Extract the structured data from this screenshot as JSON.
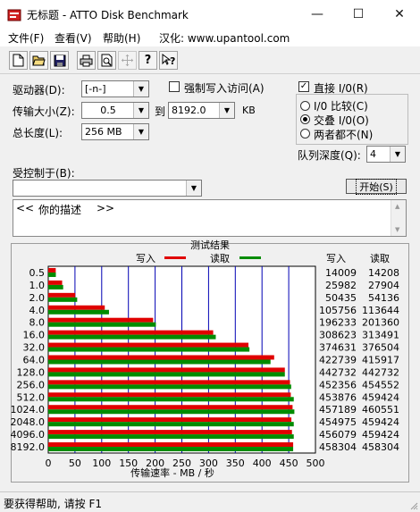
{
  "window": {
    "title": "无标题 - ATTO Disk Benchmark",
    "minimize": "—",
    "maximize": "☐",
    "close": "✕"
  },
  "menu": {
    "file": "文件(F)",
    "view": "查看(V)",
    "help": "帮助(H)",
    "credit": "汉化: www.upantool.com"
  },
  "toolbar_icons": [
    "new-icon",
    "open-icon",
    "save-icon",
    "print-icon",
    "print-preview-icon",
    "move-icon",
    "help-icon",
    "context-help-icon"
  ],
  "settings": {
    "drive_label": "驱动器(D):",
    "drive_value": "[-n-]",
    "transfer_label": "传输大小(Z):",
    "transfer_from": "0.5",
    "to_label": "到",
    "transfer_to": "8192.0",
    "kb_label": "KB",
    "length_label": "总长度(L):",
    "length_value": "256 MB",
    "force_write_label": "强制写入访问(A)",
    "force_write_checked": false,
    "direct_io_label": "直接 I/0(R)",
    "direct_io_checked": true,
    "io_compare_label": "I/0 比较(C)",
    "overlapped_io_label": "交叠 I/0(O)",
    "neither_label": "两者都不(N)",
    "selected_io_mode": "overlapped",
    "queue_depth_label": "队列深度(Q):",
    "queue_depth_value": "4",
    "controlled_by_label": "受控制于(B):",
    "controlled_by_value": "",
    "start_button": "开始(S)",
    "description_left": "<<",
    "description_text": "你的描述",
    "description_right": ">>"
  },
  "status_text": "要获得帮助, 请按 F1",
  "chart_data": {
    "type": "bar",
    "orientation": "horizontal",
    "title": "测试结果",
    "xlabel": "传输速率 - MB / 秒",
    "xlim": [
      0,
      500
    ],
    "xticks": [
      0,
      50,
      100,
      150,
      200,
      250,
      300,
      350,
      400,
      450,
      500
    ],
    "categories": [
      "0.5",
      "1.0",
      "2.0",
      "4.0",
      "8.0",
      "16.0",
      "32.0",
      "64.0",
      "128.0",
      "256.0",
      "512.0",
      "1024.0",
      "2048.0",
      "4096.0",
      "8192.0"
    ],
    "series": [
      {
        "name": "写入",
        "color": "#e00000",
        "values": [
          14009,
          25982,
          50435,
          105756,
          196233,
          308623,
          374631,
          422739,
          442732,
          452356,
          453876,
          457189,
          454975,
          456079,
          458304
        ]
      },
      {
        "name": "读取",
        "color": "#008c00",
        "values": [
          14208,
          27904,
          54136,
          113644,
          201360,
          313491,
          376504,
          415917,
          442732,
          454552,
          459424,
          460551,
          459424,
          459424,
          458304
        ]
      }
    ],
    "table_headers": [
      "写入",
      "读取"
    ],
    "values_unit_note": "",
    "grid": true
  }
}
